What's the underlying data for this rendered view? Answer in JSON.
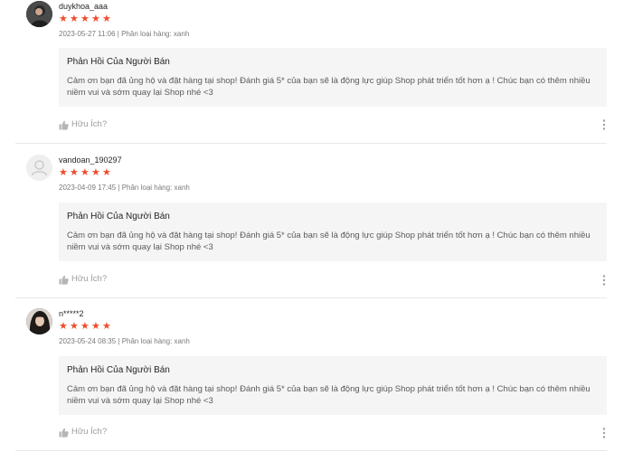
{
  "colors": {
    "star": "#ee4d2d",
    "reply_background": "#f5f5f5",
    "muted_text": "#9e9e9e"
  },
  "reviews": [
    {
      "username": "duykhoa_aaa",
      "rating": 5,
      "star_glyph": "★",
      "meta": "2023-05-27 11:06 | Phân loại hàng: xanh",
      "avatar_icon": "user-photo-icon",
      "reply_title": "Phản Hồi Của Người Bán",
      "reply_text": "Cảm ơn bạn đã ủng hộ và đặt hàng tại shop! Đánh giá 5* của bạn sẽ là động lực giúp Shop phát triển tốt hơn ạ ! Chúc bạn có thêm nhiều niềm vui và sớm quay lại Shop nhé <3",
      "helpful_label": "Hữu Ích?",
      "helpful_icon": "thumbs-up-icon",
      "more_icon": "more-vertical-icon"
    },
    {
      "username": "vandoan_190297",
      "rating": 5,
      "star_glyph": "★",
      "meta": "2023-04-09 17:45 | Phân loại hàng: xanh",
      "avatar_icon": "default-user-icon",
      "reply_title": "Phản Hồi Của Người Bán",
      "reply_text": "Cảm ơn bạn đã ủng hộ và đặt hàng tại shop! Đánh giá 5* của bạn sẽ là động lực giúp Shop phát triển tốt hơn ạ ! Chúc bạn có thêm nhiều niềm vui và sớm quay lại Shop nhé <3",
      "helpful_label": "Hữu Ích?",
      "helpful_icon": "thumbs-up-icon",
      "more_icon": "more-vertical-icon"
    },
    {
      "username": "n*****2",
      "rating": 5,
      "star_glyph": "★",
      "meta": "2023-05-24 08:35 | Phân loại hàng: xanh",
      "avatar_icon": "user-photo-icon",
      "reply_title": "Phản Hồi Của Người Bán",
      "reply_text": "Cảm ơn bạn đã ủng hộ và đặt hàng tại shop! Đánh giá 5* của bạn sẽ là động lực giúp Shop phát triển tốt hơn ạ ! Chúc bạn có thêm nhiều niềm vui và sớm quay lại Shop nhé <3",
      "helpful_label": "Hữu Ích?",
      "helpful_icon": "thumbs-up-icon",
      "more_icon": "more-vertical-icon"
    }
  ]
}
